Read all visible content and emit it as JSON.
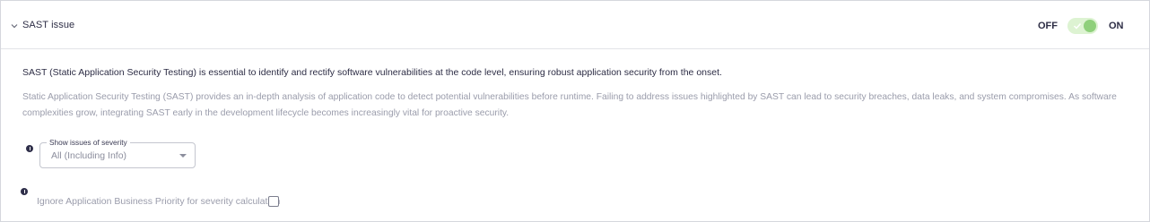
{
  "section": {
    "title": "SAST issue",
    "toggle": {
      "off_label": "OFF",
      "on_label": "ON",
      "state": "on",
      "track_color": "#ddf3d2",
      "knob_color": "#8fd07b"
    }
  },
  "content": {
    "lead": "SAST (Static Application Security Testing) is essential to identify and rectify software vulnerabilities at the code level, ensuring robust application security from the onset.",
    "description": "Static Application Security Testing (SAST) provides an in-depth analysis of application code to detect potential vulnerabilities before runtime. Failing to address issues highlighted by SAST can lead to security breaches, data leaks, and system compromises. As software complexities grow, integrating SAST early in the development lifecycle becomes increasingly vital for proactive security."
  },
  "severity_filter": {
    "label": "Show issues of severity",
    "value": "All (Including Info)",
    "icon": "info-icon"
  },
  "ignore_priority": {
    "label": "Ignore Application Business Priority for severity calculation",
    "checked": false,
    "icon": "info-icon"
  }
}
